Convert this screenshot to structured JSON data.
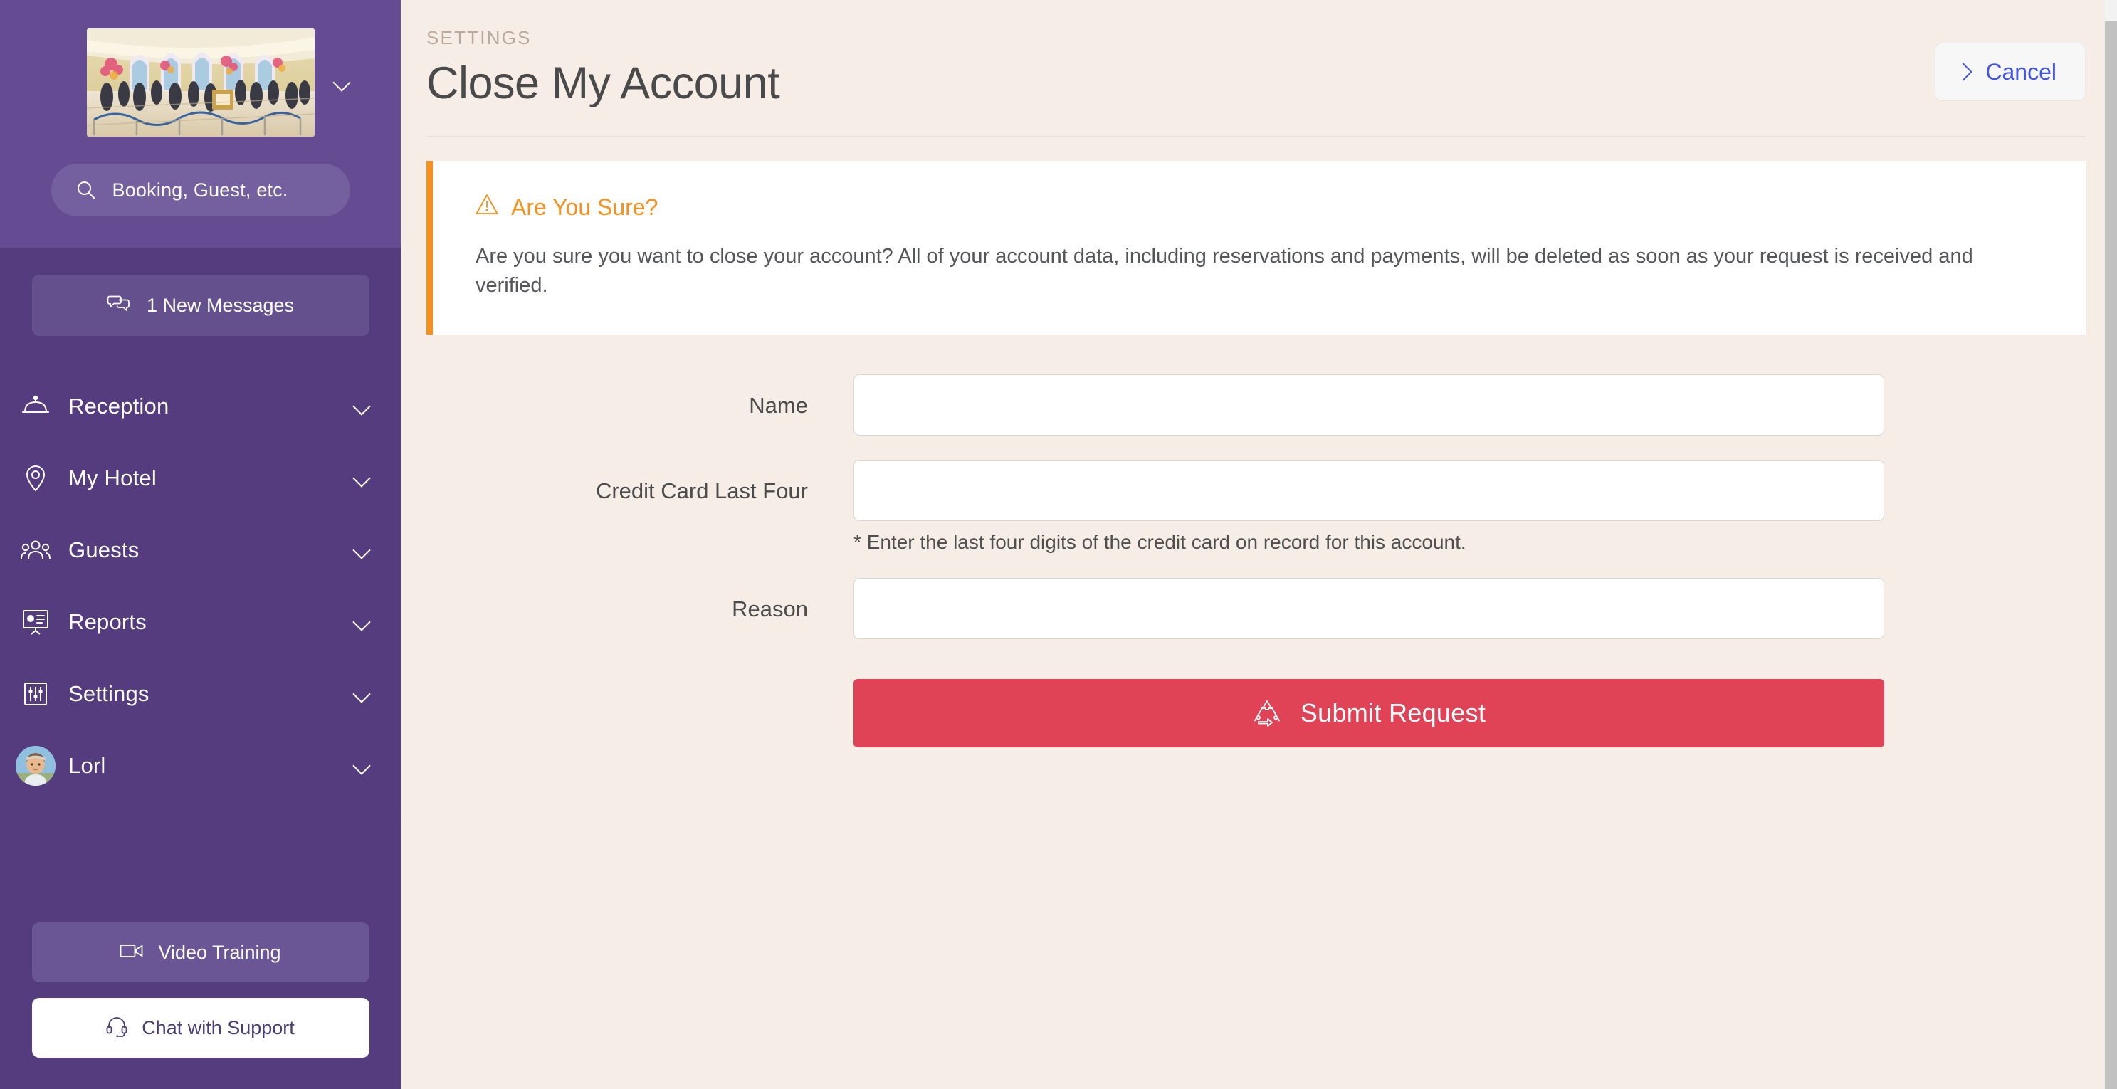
{
  "sidebar": {
    "hotel_photo": {
      "icon": "hotel-lobby-photo",
      "alt": "Hotel lobby with guests in queue"
    },
    "hotel_chevron_icon": "chevron-down-icon",
    "search": {
      "icon": "search-icon",
      "placeholder": "Booking, Guest, etc.",
      "value": ""
    },
    "messages_button": {
      "icon": "chat-bubbles-icon",
      "label": "1 New Messages"
    },
    "nav_items": [
      {
        "label": "Reception",
        "icon": "reception-bell-icon",
        "chevron": "chevron-down-icon"
      },
      {
        "label": "My Hotel",
        "icon": "map-pin-icon",
        "chevron": "chevron-down-icon"
      },
      {
        "label": "Guests",
        "icon": "people-group-icon",
        "chevron": "chevron-down-icon"
      },
      {
        "label": "Reports",
        "icon": "presentation-chart-icon",
        "chevron": "chevron-down-icon"
      },
      {
        "label": "Settings",
        "icon": "sliders-icon",
        "chevron": "chevron-down-icon"
      }
    ],
    "user": {
      "name": "Lorl",
      "avatar_icon": "user-avatar",
      "chevron": "chevron-down-icon"
    },
    "video_training": {
      "icon": "video-camera-icon",
      "label": "Video Training"
    },
    "chat_support": {
      "icon": "headset-icon",
      "label": "Chat with Support"
    }
  },
  "header": {
    "eyebrow": "SETTINGS",
    "title": "Close My Account",
    "cancel": {
      "label": "Cancel",
      "icon": "chevron-right-icon"
    }
  },
  "alert": {
    "icon": "warning-triangle-icon",
    "title": "Are You Sure?",
    "body": "Are you sure you want to close your account? All of your account data, including reservations and payments, will be deleted as soon as your request is received and verified."
  },
  "form": {
    "fields": [
      {
        "label": "Name",
        "value": "",
        "placeholder": "",
        "help": ""
      },
      {
        "label": "Credit Card Last Four",
        "value": "",
        "placeholder": "",
        "help": "* Enter the last four digits of the credit card on record for this account."
      },
      {
        "label": "Reason",
        "value": "",
        "placeholder": "",
        "help": ""
      }
    ],
    "submit": {
      "label": "Submit Request",
      "icon": "recycle-icon"
    }
  },
  "colors": {
    "sidebar_purple": "#543C7E",
    "sidebar_top_purple": "#654B91",
    "page_background": "#F7EDE7",
    "accent_red": "#E04356",
    "warning_orange": "#F6901E",
    "link_blue": "#4355E8"
  }
}
